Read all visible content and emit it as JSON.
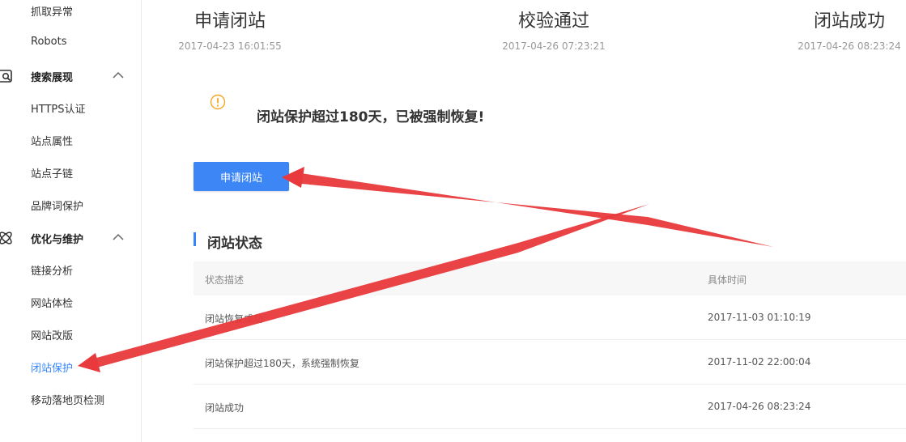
{
  "sidebar": {
    "top_items": [
      "抓取异常",
      "Robots"
    ],
    "groups": [
      {
        "label": "搜索展现",
        "items": [
          "HTTPS认证",
          "站点属性",
          "站点子链",
          "品牌词保护"
        ]
      },
      {
        "label": "优化与维护",
        "items": [
          "链接分析",
          "网站体检",
          "网站改版",
          "闭站保护",
          "移动落地页检测"
        ]
      }
    ],
    "active_item": "闭站保护",
    "active_color": "#3385ff"
  },
  "steps": [
    {
      "title": "申请闭站",
      "time": "2017-04-23 16:01:55"
    },
    {
      "title": "校验通过",
      "time": "2017-04-26 07:23:21"
    },
    {
      "title": "闭站成功",
      "time": "2017-04-26 08:23:24"
    }
  ],
  "notice": {
    "icon": "warning-circle-icon",
    "text": "闭站保护超过180天，已被强制恢复!",
    "icon_color": "#f5a623"
  },
  "apply_button": {
    "label": "申请闭站",
    "color": "#3d86f5"
  },
  "status_section": {
    "title": "闭站状态",
    "columns": [
      "状态描述",
      "具体时间"
    ],
    "rows": [
      {
        "desc": "闭站恢复成功",
        "time": "2017-11-03 01:10:19"
      },
      {
        "desc": "闭站保护超过180天，系统强制恢复",
        "time": "2017-11-02 22:00:04"
      },
      {
        "desc": "闭站成功",
        "time": "2017-04-26 08:23:24"
      }
    ]
  },
  "annotation_color": "#e8393c"
}
